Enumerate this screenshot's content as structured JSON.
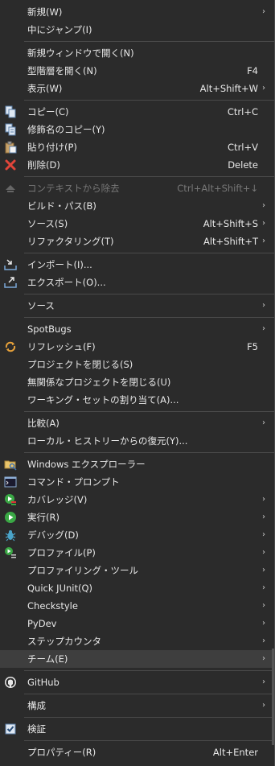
{
  "menu": {
    "new": {
      "label": "新規(W)"
    },
    "go_into": {
      "label": "中にジャンプ(I)"
    },
    "open_new_window": {
      "label": "新規ウィンドウで開く(N)"
    },
    "open_type_hierarchy": {
      "label": "型階層を開く(N)",
      "shortcut": "F4"
    },
    "show_in": {
      "label": "表示(W)",
      "shortcut": "Alt+Shift+W"
    },
    "copy": {
      "label": "コピー(C)",
      "shortcut": "Ctrl+C"
    },
    "copy_qualified": {
      "label": "修飾名のコピー(Y)"
    },
    "paste": {
      "label": "貼り付け(P)",
      "shortcut": "Ctrl+V"
    },
    "delete": {
      "label": "削除(D)",
      "shortcut": "Delete"
    },
    "remove_context": {
      "label": "コンテキストから除去",
      "shortcut": "Ctrl+Alt+Shift+↓"
    },
    "build_path": {
      "label": "ビルド・パス(B)"
    },
    "source_s": {
      "label": "ソース(S)",
      "shortcut": "Alt+Shift+S"
    },
    "refactoring": {
      "label": "リファクタリング(T)",
      "shortcut": "Alt+Shift+T"
    },
    "import": {
      "label": "インポート(I)..."
    },
    "export": {
      "label": "エクスポート(O)..."
    },
    "source": {
      "label": "ソース"
    },
    "spotbugs": {
      "label": "SpotBugs"
    },
    "refresh": {
      "label": "リフレッシュ(F)",
      "shortcut": "F5"
    },
    "close_project": {
      "label": "プロジェクトを閉じる(S)"
    },
    "close_unrelated": {
      "label": "無関係なプロジェクトを閉じる(U)"
    },
    "assign_working_sets": {
      "label": "ワーキング・セットの割り当て(A)..."
    },
    "compare": {
      "label": "比較(A)"
    },
    "restore_local": {
      "label": "ローカル・ヒストリーからの復元(Y)..."
    },
    "windows_explorer": {
      "label": "Windows エクスプローラー"
    },
    "command_prompt": {
      "label": "コマンド・プロンプト"
    },
    "coverage": {
      "label": "カバレッジ(V)"
    },
    "run": {
      "label": "実行(R)"
    },
    "debug": {
      "label": "デバッグ(D)"
    },
    "profile": {
      "label": "プロファイル(P)"
    },
    "profiling_tools": {
      "label": "プロファイリング・ツール"
    },
    "quick_junit": {
      "label": "Quick JUnit(Q)"
    },
    "checkstyle": {
      "label": "Checkstyle"
    },
    "pydev": {
      "label": "PyDev"
    },
    "step_counter": {
      "label": "ステップカウンタ"
    },
    "team": {
      "label": "チーム(E)"
    },
    "github": {
      "label": "GitHub"
    },
    "configure": {
      "label": "構成"
    },
    "validate": {
      "label": "検証"
    },
    "properties": {
      "label": "プロパティー(R)",
      "shortcut": "Alt+Enter"
    },
    "submenu_arrow": "›"
  },
  "colors": {
    "background": "#2b2b2b",
    "text": "#e8e8e8",
    "disabled": "#777777",
    "separator": "#4a4a4a",
    "highlight": "#3e3e3e"
  }
}
